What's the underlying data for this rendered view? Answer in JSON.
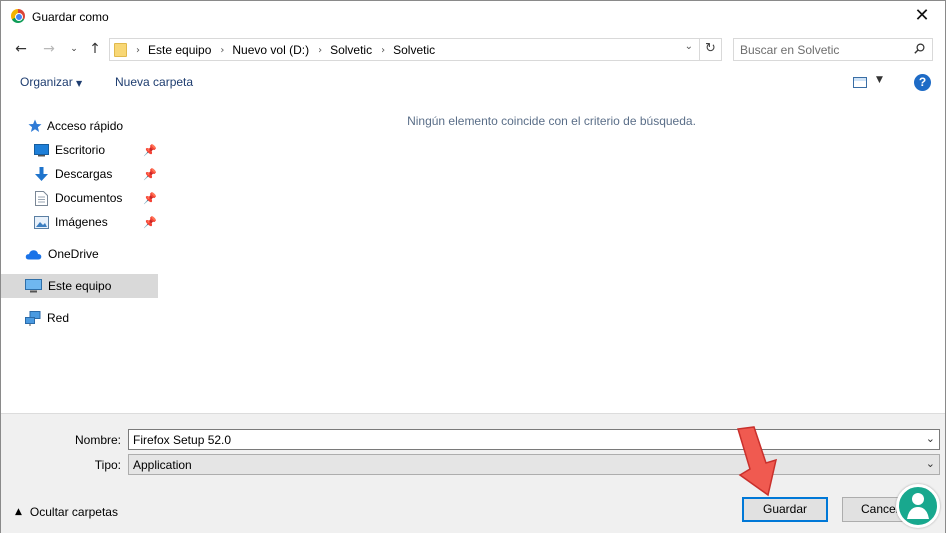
{
  "window": {
    "title": "Guardar como",
    "close_glyph": "✕"
  },
  "nav": {
    "back_icon": "arrow-left-icon",
    "forward_icon": "arrow-right-icon",
    "recent_icon": "chevron-down-icon",
    "up_icon": "arrow-up-icon",
    "breadcrumbs": [
      "Este equipo",
      "Nuevo vol (D:)",
      "Solvetic",
      "Solvetic"
    ],
    "search_placeholder": "Buscar en Solvetic"
  },
  "commands": {
    "organize": "Organizar",
    "new_folder": "Nueva carpeta"
  },
  "sidebar": {
    "quick_access": "Acceso rápido",
    "items": [
      {
        "label": "Escritorio",
        "icon": "desktop-icon",
        "pinned": true
      },
      {
        "label": "Descargas",
        "icon": "download-icon",
        "pinned": true
      },
      {
        "label": "Documentos",
        "icon": "document-icon",
        "pinned": true
      },
      {
        "label": "Imágenes",
        "icon": "pictures-icon",
        "pinned": true
      }
    ],
    "onedrive": "OneDrive",
    "this_pc": "Este equipo",
    "network": "Red",
    "selected": "Este equipo"
  },
  "main": {
    "empty_message": "Ningún elemento coincide con el criterio de búsqueda."
  },
  "form": {
    "name_label": "Nombre:",
    "name_value": "Firefox Setup 52.0",
    "type_label": "Tipo:",
    "type_value": "Application"
  },
  "footer": {
    "hide_folders": "Ocultar carpetas",
    "save": "Guardar",
    "cancel": "Cancelar"
  },
  "colors": {
    "accent": "#0078d7",
    "link": "#1e3d70",
    "empty_text": "#5a6e88",
    "panel_bg": "#f0f0f0",
    "annotation_arrow": "#f05a50",
    "logo": "#18a88e"
  }
}
